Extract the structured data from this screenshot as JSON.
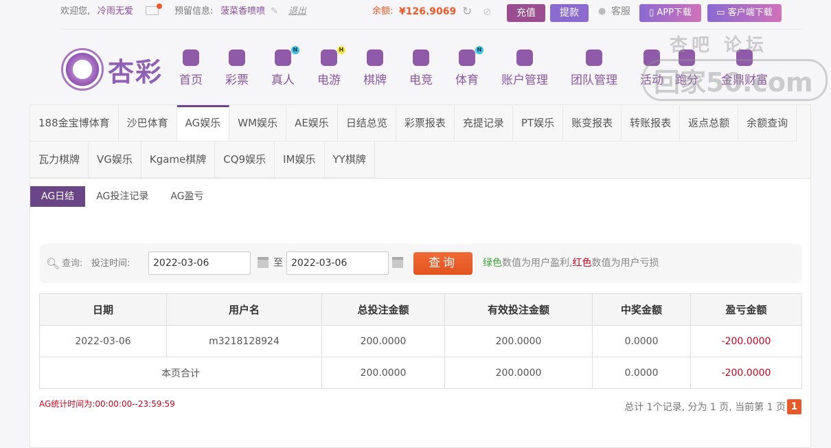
{
  "topbar": {
    "welcome": "欢迎您,",
    "username": "冷雨无爱",
    "reserved_label": "预留信息:",
    "reserved_value": "菠菜香喷喷",
    "logout": "退出",
    "balance_label": "余额:",
    "balance": "¥126.9069",
    "recharge": "充值",
    "withdraw": "提款",
    "service": "客服",
    "app_download": "APP下载",
    "client_download": "客户端下载"
  },
  "logo": {
    "text": "杏彩"
  },
  "nav": [
    {
      "label": "首页"
    },
    {
      "label": "彩票"
    },
    {
      "label": "真人",
      "badge": "N"
    },
    {
      "label": "电游",
      "badge": "H"
    },
    {
      "label": "棋牌"
    },
    {
      "label": "电竞"
    },
    {
      "label": "体育",
      "badge": "N"
    },
    {
      "label": "账户管理"
    },
    {
      "label": "团队管理"
    },
    {
      "label": "活动"
    },
    {
      "label": "跑分"
    },
    {
      "label": "金鼎财富"
    }
  ],
  "watermark": {
    "line1": "杏吧 论坛",
    "line2": "回家50.com"
  },
  "tabs": [
    "188金宝博体育",
    "沙巴体育",
    "AG娱乐",
    "WM娱乐",
    "AE娱乐",
    "日结总览",
    "彩票报表",
    "充提记录",
    "PT娱乐",
    "账变报表",
    "转账报表",
    "返点总额",
    "余额查询",
    "瓦力棋牌",
    "VG娱乐",
    "Kgame棋牌",
    "CQ9娱乐",
    "IM娱乐",
    "YY棋牌"
  ],
  "subtabs": [
    "AG日结",
    "AG投注记录",
    "AG盈亏"
  ],
  "query": {
    "label": "查询:",
    "time_label": "投注时间:",
    "start": "2022-03-06",
    "to": "至",
    "end": "2022-03-06",
    "button": "查询",
    "hint_green": "绿色",
    "hint_mid": "数值为用户盈利,",
    "hint_red": "红色",
    "hint_end": "数值为用户亏损"
  },
  "table": {
    "headers": [
      "日期",
      "用户名",
      "总投注金额",
      "有效投注金额",
      "中奖金额",
      "盈亏金额"
    ],
    "row": [
      "2022-03-06",
      "m3218128924",
      "200.0000",
      "200.0000",
      "0.0000",
      "-200.0000"
    ],
    "total": [
      "本页合计",
      "200.0000",
      "200.0000",
      "0.0000",
      "-200.0000"
    ]
  },
  "footer": {
    "stat": "AG统计时间为:00:00:00--23:59:59",
    "pager": "总计 1个记录, 分为 1 页, 当前第 1 页",
    "page": "1"
  },
  "colors": {
    "accent": "#6b4687",
    "orange": "#e8592a",
    "red": "#d0021b",
    "green": "#3aa534"
  }
}
